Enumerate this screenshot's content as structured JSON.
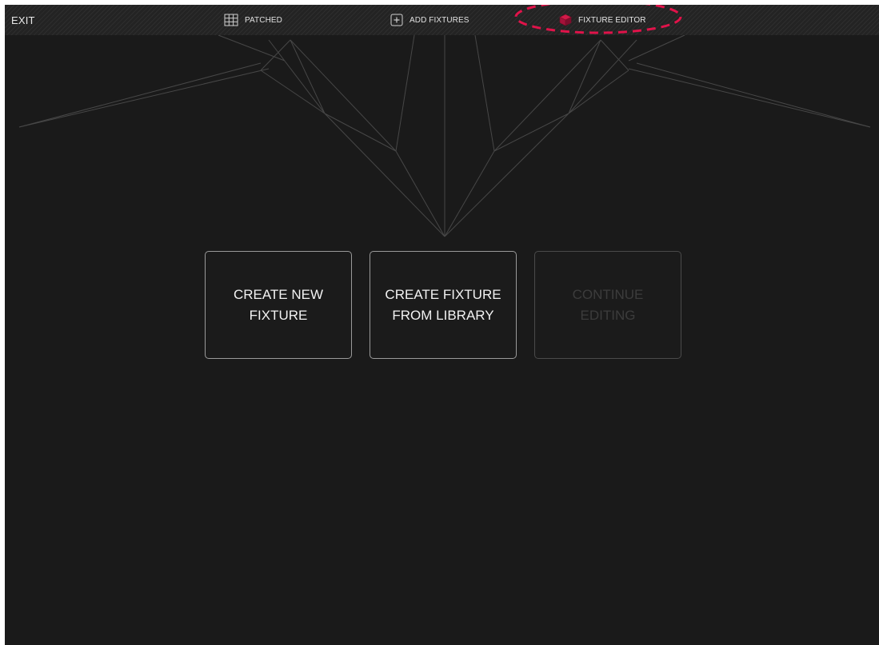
{
  "topbar": {
    "exit_label": "EXIT",
    "tabs": [
      {
        "label": "PATCHED",
        "icon": "grid-icon",
        "active": false
      },
      {
        "label": "ADD FIXTURES",
        "icon": "plus-box-icon",
        "active": false
      },
      {
        "label": "FIXTURE EDITOR",
        "icon": "cube-icon",
        "active": true
      }
    ]
  },
  "main": {
    "buttons": [
      {
        "label": "CREATE NEW FIXTURE",
        "enabled": true
      },
      {
        "label": "CREATE FIXTURE FROM LIBRARY",
        "enabled": true
      },
      {
        "label": "CONTINUE EDITING",
        "enabled": false
      }
    ]
  },
  "colors": {
    "background": "#1a1a1a",
    "topbar": "#232323",
    "active_icon": "#c0163f",
    "annotation": "#e0134a",
    "disabled_text": "#3c3c3c"
  }
}
